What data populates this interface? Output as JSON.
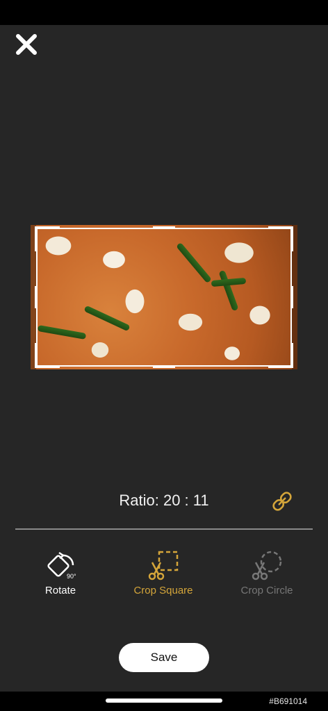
{
  "ratio": {
    "text": "Ratio: 20 : 11"
  },
  "tools": {
    "rotate": {
      "label": "Rotate",
      "badge": "90°"
    },
    "crop_square": {
      "label": "Crop Square",
      "active": true
    },
    "crop_circle": {
      "label": "Crop Circle",
      "enabled": false
    }
  },
  "save": {
    "label": "Save"
  },
  "build_id": "#B691014",
  "icons": {
    "close": "close-icon",
    "link": "link-icon",
    "rotate": "rotate-icon",
    "crop_square": "scissors-square-icon",
    "crop_circle": "scissors-circle-icon"
  },
  "colors": {
    "background": "#262626",
    "accent": "#d4a53a",
    "disabled": "#777777",
    "text": "#ffffff"
  }
}
